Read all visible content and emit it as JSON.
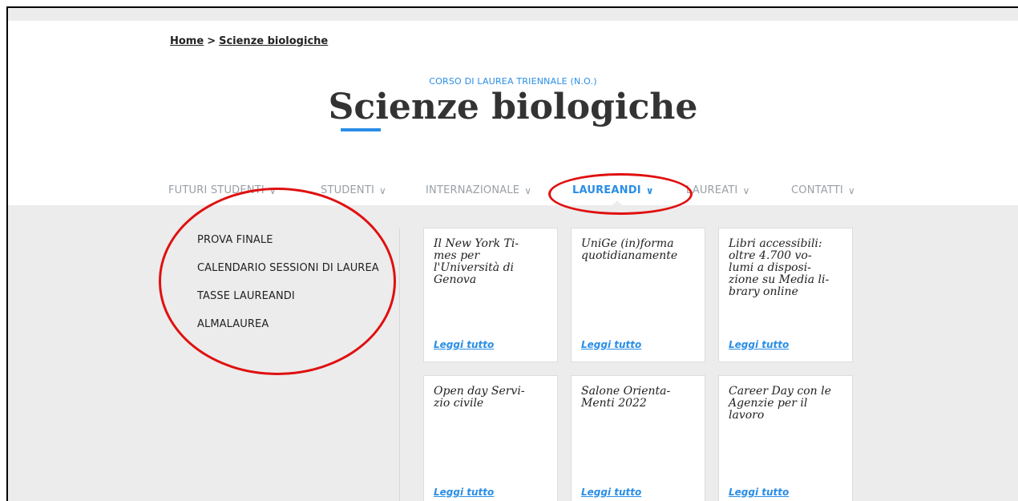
{
  "breadcrumb": {
    "home": "Home",
    "separator": ">",
    "current": "Scienze biologiche"
  },
  "hero": {
    "subtitle": "CORSO DI LAUREA TRIENNALE (N.O.)",
    "title": "Scienze biologiche"
  },
  "nav": {
    "items": [
      {
        "label": "FUTURI STUDENTI",
        "chevron": "∨"
      },
      {
        "label": "STUDENTI",
        "chevron": "∨"
      },
      {
        "label": "INTERNAZIONALE",
        "chevron": "∨"
      },
      {
        "label": "LAUREANDI",
        "chevron": "∨"
      },
      {
        "label": "LAUREATI",
        "chevron": "∨"
      },
      {
        "label": "CONTATTI",
        "chevron": "∨"
      }
    ],
    "active": "LAUREANDI"
  },
  "submenu": [
    "PROVA FINALE",
    "CALENDARIO SESSIONI DI LAUREA",
    "TASSE LAUREANDI",
    "ALMALAUREA"
  ],
  "cards": [
    {
      "title": "Il New York Ti-\nmes per\nl'Università di\nGenova",
      "link": "Leggi tutto"
    },
    {
      "title": "UniGe (in)forma\nquotidianamente",
      "link": "Leggi tutto"
    },
    {
      "title": "Libri accessibili:\noltre 4.700 vo-\nlumi a disposi-\nzione su Media li-\nbrary online",
      "link": "Leggi tutto"
    },
    {
      "title": "Open day Servi-\nzio civile",
      "link": "Leggi tutto"
    },
    {
      "title": "Salone Orienta-\nMenti 2022",
      "link": "Leggi tutto"
    },
    {
      "title": "Career Day con le\nAgenzie per il\nlavoro",
      "link": "Leggi tutto"
    }
  ],
  "colors": {
    "accent": "#2a8ee6",
    "annotation": "#e01010",
    "panel": "#ececec"
  }
}
